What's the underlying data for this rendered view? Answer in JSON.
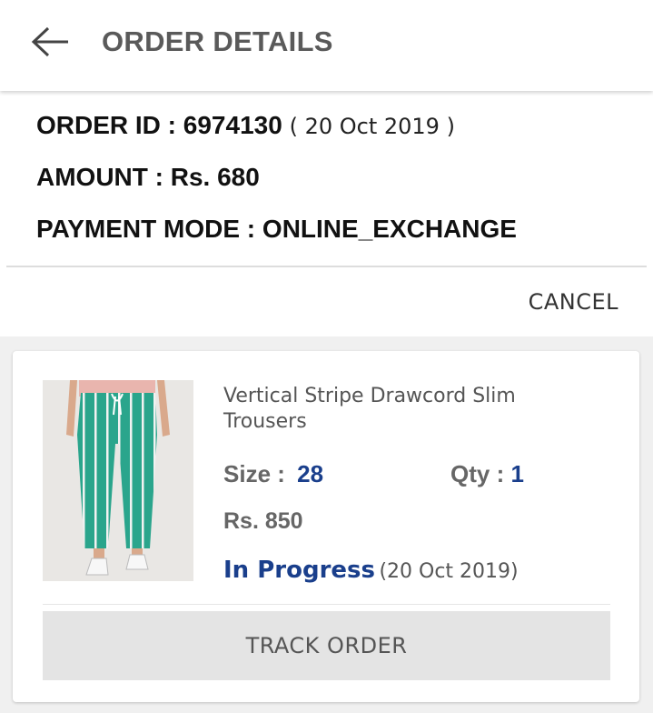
{
  "appbar": {
    "title": "ORDER DETAILS",
    "back_icon": "arrow-left-icon"
  },
  "order": {
    "id_label": "ORDER ID : 6974130",
    "date": "( 20 Oct 2019 )",
    "amount_label": "AMOUNT : Rs. 680",
    "payment_label": "PAYMENT MODE : ONLINE_EXCHANGE",
    "cancel_label": "CANCEL"
  },
  "item": {
    "name": "Vertical Stripe Drawcord Slim Trousers",
    "size_label": "Size :",
    "size_value": "28",
    "qty_label": "Qty :",
    "qty_value": "1",
    "price": "Rs. 850",
    "status": "In Progress",
    "status_date": "(20 Oct 2019)",
    "track_label": "TRACK ORDER"
  },
  "colors": {
    "accent": "#1a3f8c",
    "pants": "#2aa58c"
  }
}
